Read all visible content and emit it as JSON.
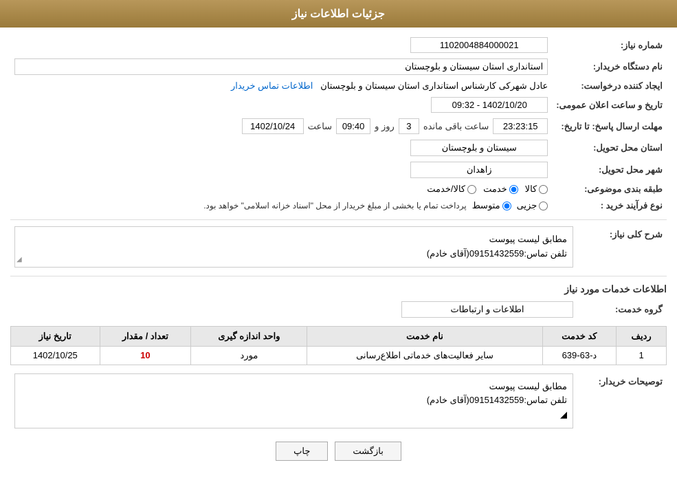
{
  "page": {
    "title": "جزئیات اطلاعات نیاز"
  },
  "header": {
    "label": "جزئیات اطلاعات نیاز"
  },
  "fields": {
    "shomareNiaz_label": "شماره نیاز:",
    "shomareNiaz_value": "1102004884000021",
    "namDastgah_label": "نام دستگاه خریدار:",
    "namDastgah_value": "استانداری استان سیستان و بلوچستان",
    "ejadKonande_label": "ایجاد کننده درخواست:",
    "ejadKonande_value": "عادل شهرکی کارشناس استانداری استان سیستان و بلوچستان",
    "ejadKonande_link": "اطلاعات تماس خریدار",
    "tarikh_label": "تاریخ و ساعت اعلان عمومی:",
    "tarikh_value": "1402/10/20 - 09:32",
    "mohlat_label": "مهلت ارسال پاسخ: تا تاریخ:",
    "mohlat_date": "1402/10/24",
    "mohlat_saat_label": "ساعت",
    "mohlat_saat": "09:40",
    "mohlat_rooz_label": "روز و",
    "mohlat_rooz": "3",
    "mohlat_baqi_label": "ساعت باقی مانده",
    "mohlat_baqi": "23:23:15",
    "ostan_label": "استان محل تحویل:",
    "ostan_value": "سیستان و بلوچستان",
    "shahr_label": "شهر محل تحویل:",
    "shahr_value": "زاهدان",
    "tabaqe_label": "طبقه بندی موضوعی:",
    "tabaqe_kala": "کالا",
    "tabaqe_khedmat": "خدمت",
    "tabaqe_kala_khedmat": "کالا/خدمت",
    "tabaqe_selected": "khedmat",
    "noeFarayand_label": "نوع فرآیند خرید :",
    "noeFarayand_jozii": "جزیی",
    "noeFarayand_motevaset": "متوسط",
    "noeFarayand_desc": "پرداخت تمام یا بخشی از مبلغ خریدار از محل \"اسناد خزانه اسلامی\" خواهد بود.",
    "noeFarayand_selected": "motevaset",
    "sharh_label": "شرح کلی نیاز:",
    "sharh_value": "مطابق لیست پیوست",
    "sharh_telefon": "تلفن تماس:09151432559(آقای خادم)",
    "khadamat_label": "اطلاعات خدمات مورد نیاز",
    "grouh_label": "گروه خدمت:",
    "grouh_value": "اطلاعات و ارتباطات",
    "table": {
      "headers": [
        "ردیف",
        "کد خدمت",
        "نام خدمت",
        "واحد اندازه گیری",
        "تعداد / مقدار",
        "تاریخ نیاز"
      ],
      "rows": [
        {
          "radif": "1",
          "kod": "د-63-639",
          "nam": "سایر فعالیت‌های خدماتی اطلاع‌رسانی",
          "vahed": "مورد",
          "tedad": "10",
          "tarikh": "1402/10/25"
        }
      ]
    },
    "toseeh_label": "توصیحات خریدار:",
    "toseeh_value": "مطابق لیست پیوست",
    "toseeh_telefon": "تلفن تماس:09151432559(آقای خادم)"
  },
  "buttons": {
    "back": "بازگشت",
    "print": "چاپ"
  }
}
